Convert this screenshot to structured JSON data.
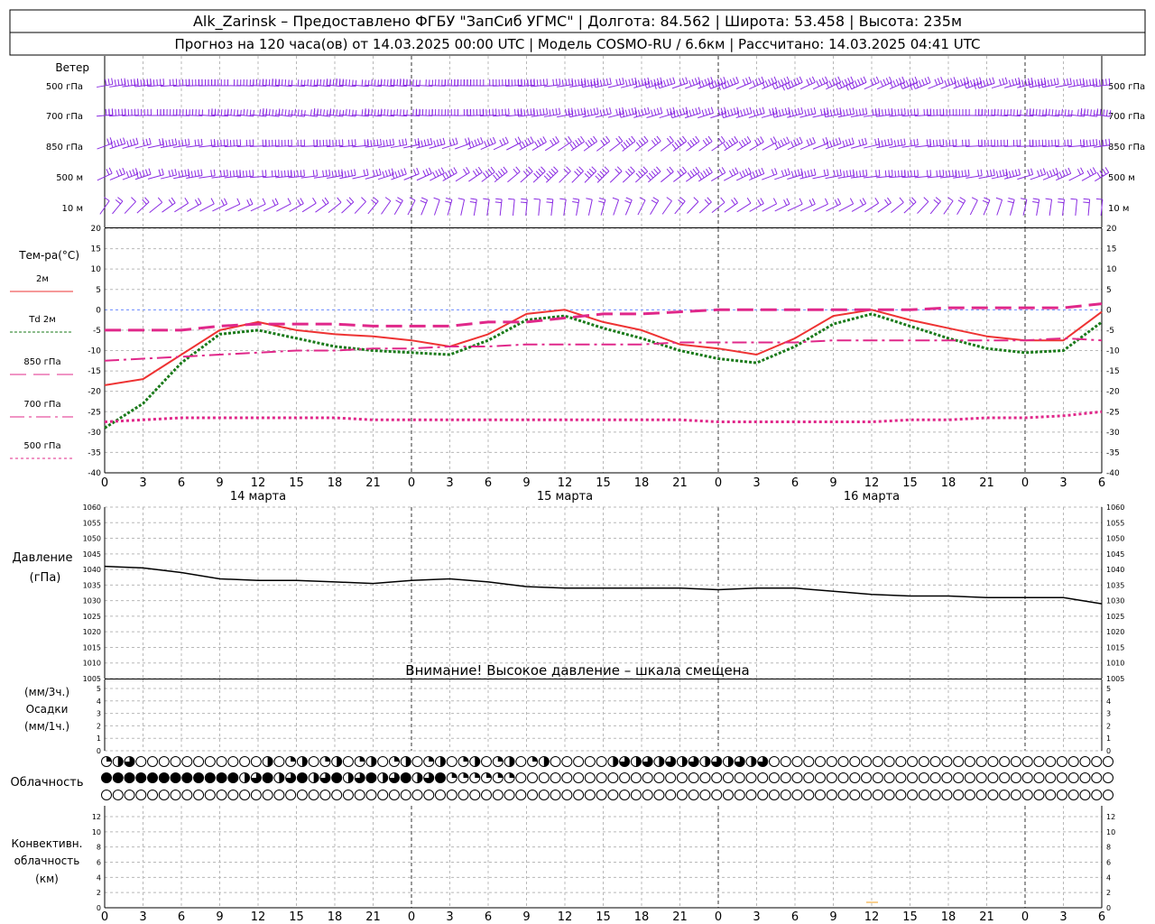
{
  "header": {
    "line1": "Alk_Zarinsk – Предоставлено ФГБУ \"ЗапСиб УГМС\" | Долгота: 84.562 | Широта: 53.458 | Высота: 235м",
    "line2": "Прогноз на 120 часа(ов) от 14.03.2025 00:00 UTC  | Модель COSMO-RU / 6.6км | Рассчитано: 14.03.2025 04:41 UTC"
  },
  "wind": {
    "title": "Ветер",
    "levels": [
      "500 гПа",
      "700 гПа",
      "850 гПа",
      "500 м",
      "10  м"
    ],
    "color": "#8a2be2"
  },
  "temperature": {
    "label": "Тем-ра(°C)",
    "ylim": [
      -40,
      20
    ],
    "yticks": [
      20,
      15,
      10,
      5,
      0,
      -5,
      -10,
      -15,
      -20,
      -25,
      -30,
      -35,
      -40
    ],
    "legend": [
      {
        "name": "2м",
        "color": "#ee3333"
      },
      {
        "name": "Td 2м",
        "color": "#1a7a1a"
      },
      {
        "name": "850 гПа",
        "color": "#e0288a"
      },
      {
        "name": "700 гПа",
        "color": "#e0288a"
      },
      {
        "name": "500 гПа",
        "color": "#e0288a"
      }
    ],
    "days": [
      "14 марта",
      "15 марта",
      "16 марта"
    ]
  },
  "pressure": {
    "label1": "Давление",
    "label2": "(гПа)",
    "ylim": [
      1005,
      1060
    ],
    "yticks": [
      1060,
      1055,
      1050,
      1045,
      1040,
      1035,
      1030,
      1025,
      1020,
      1015,
      1010,
      1005
    ],
    "warning": "Внимание! Высокое давление – шкала смещена"
  },
  "precip": {
    "label1": "(мм/3ч.)",
    "label2": "Осадки",
    "label3": "(мм/1ч.)",
    "yticks": [
      5,
      4,
      3,
      2,
      1,
      0
    ]
  },
  "clouds": {
    "label": "Облачность"
  },
  "convective": {
    "label1": "Конвективн.",
    "label2": "облачность",
    "label3": "(км)",
    "yticks": [
      12,
      10,
      8,
      6,
      4,
      2,
      0
    ]
  },
  "x_ticks": [
    "0",
    "3",
    "6",
    "9",
    "12",
    "15",
    "18",
    "21",
    "0",
    "3",
    "6",
    "9",
    "12",
    "15",
    "18",
    "21",
    "0",
    "3",
    "6",
    "9",
    "12",
    "15",
    "18",
    "21",
    "0",
    "3",
    "6"
  ],
  "chart_data": [
    {
      "type": "line",
      "title": "Тем-ра(°C)",
      "x": [
        0,
        3,
        6,
        9,
        12,
        15,
        18,
        21,
        24,
        27,
        30,
        33,
        36,
        39,
        42,
        45,
        48,
        51,
        54,
        57,
        60,
        63,
        66,
        69,
        72,
        75,
        78
      ],
      "ylim": [
        -40,
        20
      ],
      "series": [
        {
          "name": "2м",
          "values": [
            -18.5,
            -17,
            -11,
            -5,
            -3,
            -5,
            -6,
            -6.5,
            -7.5,
            -9,
            -6,
            -1,
            0,
            -3,
            -5,
            -8.5,
            -9.5,
            -11,
            -7,
            -1.5,
            0,
            -2.5,
            -4.5,
            -6.5,
            -7.5,
            -7.5,
            -0.5
          ]
        },
        {
          "name": "Td 2м",
          "values": [
            -29,
            -23,
            -13,
            -6,
            -5,
            -7,
            -9,
            -10,
            -10.5,
            -11,
            -7.5,
            -2.5,
            -1.5,
            -4.5,
            -7,
            -10,
            -12,
            -13,
            -9,
            -3.5,
            -1,
            -4,
            -7,
            -9.5,
            -10.5,
            -10,
            -3
          ]
        },
        {
          "name": "850 гПа",
          "values": [
            -5,
            -5,
            -5,
            -4,
            -3.5,
            -3.5,
            -3.5,
            -4,
            -4,
            -4,
            -3,
            -3,
            -2,
            -1,
            -1,
            -0.5,
            0,
            0,
            0,
            0,
            0,
            0,
            0.5,
            0.5,
            0.5,
            0.5,
            1.5
          ]
        },
        {
          "name": "700 гПа",
          "values": [
            -12.5,
            -12,
            -11.5,
            -11,
            -10.5,
            -10,
            -10,
            -9.5,
            -9.5,
            -9,
            -9,
            -8.5,
            -8.5,
            -8.5,
            -8.5,
            -8,
            -8,
            -8,
            -8,
            -7.5,
            -7.5,
            -7.5,
            -7.5,
            -7.5,
            -7.5,
            -7,
            -7.5
          ]
        },
        {
          "name": "500 гПа",
          "values": [
            -27.5,
            -27,
            -26.5,
            -26.5,
            -26.5,
            -26.5,
            -26.5,
            -27,
            -27,
            -27,
            -27,
            -27,
            -27,
            -27,
            -27,
            -27,
            -27.5,
            -27.5,
            -27.5,
            -27.5,
            -27.5,
            -27,
            -27,
            -26.5,
            -26.5,
            -26,
            -25
          ]
        }
      ]
    },
    {
      "type": "line",
      "title": "Давление",
      "ylabel": "(гПа)",
      "ylim": [
        1005,
        1060
      ],
      "x": [
        0,
        3,
        6,
        9,
        12,
        15,
        18,
        21,
        24,
        27,
        30,
        33,
        36,
        39,
        42,
        45,
        48,
        51,
        54,
        57,
        60,
        63,
        66,
        69,
        72,
        75,
        78
      ],
      "series": [
        {
          "name": "",
          "values": [
            1041,
            1040.5,
            1039,
            1037,
            1036.5,
            1036.5,
            1036,
            1035.5,
            1036.5,
            1037,
            1036,
            1034.5,
            1034,
            1034,
            1034,
            1034,
            1033.5,
            1034,
            1034,
            1033,
            1032,
            1031.5,
            1031.5,
            1031,
            1031,
            1031,
            1029
          ]
        }
      ]
    }
  ]
}
